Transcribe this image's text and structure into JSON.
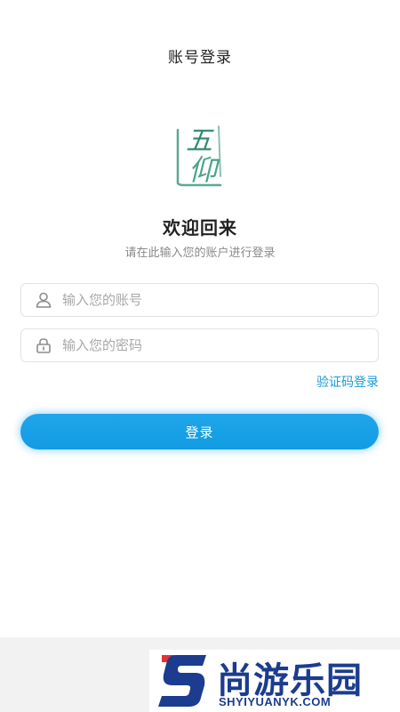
{
  "header": {
    "title": "账号登录"
  },
  "logo": {
    "glyph_top": "五",
    "glyph_bottom": "仰",
    "color": "#3e9a7a"
  },
  "welcome": {
    "title": "欢迎回来",
    "subtitle": "请在此输入您的账户进行登录"
  },
  "form": {
    "account": {
      "icon": "user-icon",
      "placeholder": "输入您的账号",
      "value": ""
    },
    "password": {
      "icon": "lock-icon",
      "placeholder": "输入您的密码",
      "value": ""
    },
    "code_login_label": "验证码登录",
    "submit_label": "登录"
  },
  "colors": {
    "accent": "#129ce2",
    "link": "#1a9ad8",
    "watermark": "#1b3c8f",
    "watermark_red": "#e8322f"
  },
  "watermark": {
    "name": "尚游乐园",
    "domain": "SHYIYUANYK.COM"
  }
}
